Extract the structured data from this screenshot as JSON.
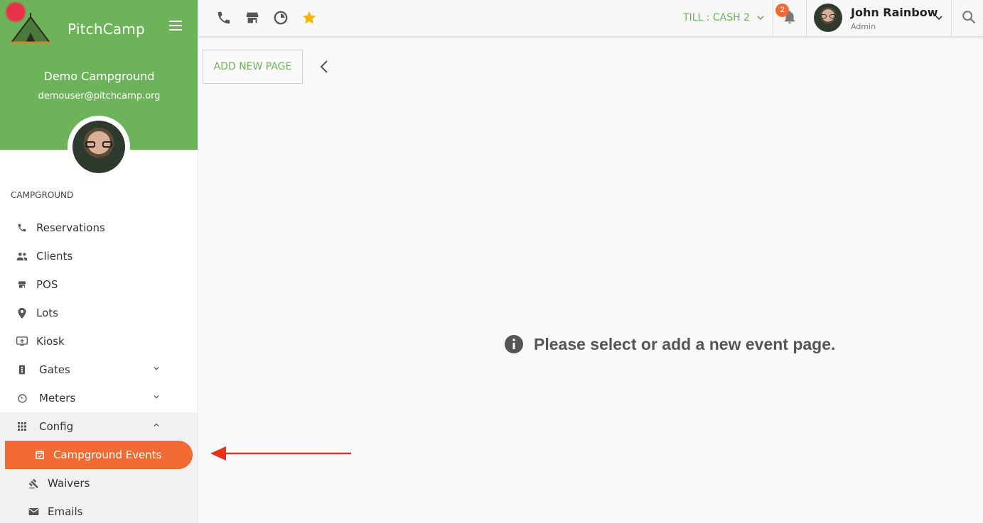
{
  "brand": {
    "name": "PitchCamp"
  },
  "campground": {
    "name": "Demo Campground",
    "email": "demouser@pitchcamp.org"
  },
  "sidebar": {
    "section_title": "CAMPGROUND",
    "items": [
      {
        "label": "Reservations",
        "icon": "phone-icon"
      },
      {
        "label": "Clients",
        "icon": "people-icon"
      },
      {
        "label": "POS",
        "icon": "store-icon"
      },
      {
        "label": "Lots",
        "icon": "map-pin-icon"
      },
      {
        "label": "Kiosk",
        "icon": "kiosk-icon"
      },
      {
        "label": "Gates",
        "icon": "gate-icon"
      },
      {
        "label": "Meters",
        "icon": "meter-icon"
      },
      {
        "label": "Config",
        "icon": "grid-icon"
      },
      {
        "label": "Campground Events",
        "icon": "calendar-icon"
      },
      {
        "label": "Waivers",
        "icon": "gavel-icon"
      },
      {
        "label": "Emails",
        "icon": "mail-icon"
      }
    ]
  },
  "topbar": {
    "till_label": "TILL : CASH 2",
    "notification_count": "2",
    "user_name": "John Rainbow",
    "user_role": "Admin"
  },
  "main": {
    "add_button_label": "ADD NEW PAGE",
    "empty_message": "Please select or add a new event page."
  },
  "colors": {
    "brand_green": "#6db35a",
    "accent_orange": "#f26b35",
    "annotation_red": "#e8301c"
  }
}
